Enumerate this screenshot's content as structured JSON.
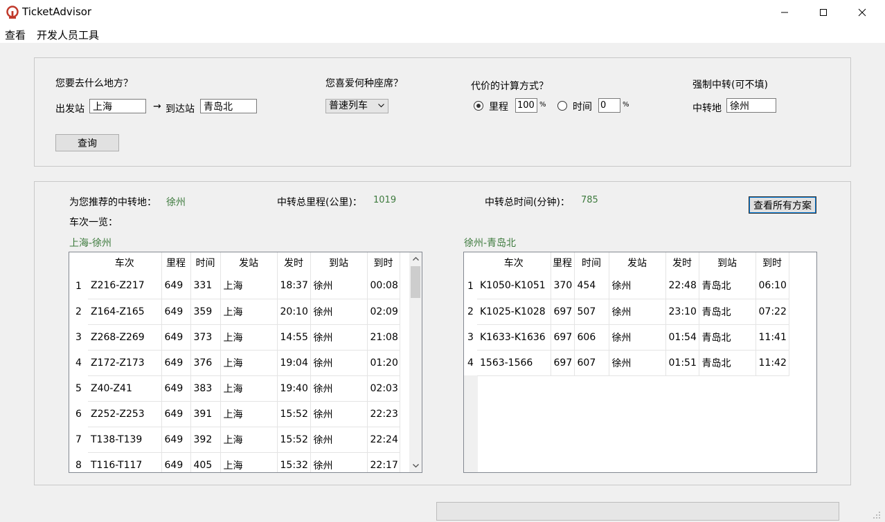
{
  "window": {
    "title": "TicketAdvisor",
    "brand_color": "#c0392b"
  },
  "menu": [
    "查看",
    "开发人员工具"
  ],
  "query": {
    "dest_question": "您要去什么地方？",
    "from_label": "出发站",
    "from_value": "上海",
    "arrow": "→",
    "to_label": "到达站",
    "to_value": "青岛北",
    "seat_question": "您喜爱何种座席？",
    "seat_value": "普速列车",
    "cost_question": "代价的计算方式？",
    "mileage_label": "里程",
    "mileage_value": "100",
    "time_label": "时间",
    "time_value": "0",
    "percent": "%",
    "transfer_question": "强制中转(可不填)",
    "transfer_label": "中转地",
    "transfer_value": "徐州",
    "search_button": "查询"
  },
  "result": {
    "recommend_label": "为您推荐的中转地：",
    "recommend_value": "徐州",
    "distance_label": "中转总里程(公里)：",
    "distance_value": "1019",
    "duration_label": "中转总时间(分钟)：",
    "duration_value": "785",
    "view_all_button": "查看所有方案",
    "trains_label": "车次一览：",
    "headers": [
      "车次",
      "里程",
      "时间",
      "发站",
      "到站",
      "发时",
      "到时"
    ],
    "leg1": {
      "title": "上海-徐州",
      "rows": [
        [
          "1",
          "Z216-Z217",
          "649",
          "331",
          "上海",
          "18:37",
          "徐州",
          "00:08"
        ],
        [
          "2",
          "Z164-Z165",
          "649",
          "359",
          "上海",
          "20:10",
          "徐州",
          "02:09"
        ],
        [
          "3",
          "Z268-Z269",
          "649",
          "373",
          "上海",
          "14:55",
          "徐州",
          "21:08"
        ],
        [
          "4",
          "Z172-Z173",
          "649",
          "376",
          "上海",
          "19:04",
          "徐州",
          "01:20"
        ],
        [
          "5",
          "Z40-Z41",
          "649",
          "383",
          "上海",
          "19:40",
          "徐州",
          "02:03"
        ],
        [
          "6",
          "Z252-Z253",
          "649",
          "391",
          "上海",
          "15:52",
          "徐州",
          "22:23"
        ],
        [
          "7",
          "T138-T139",
          "649",
          "392",
          "上海",
          "15:52",
          "徐州",
          "22:24"
        ],
        [
          "8",
          "T116-T117",
          "649",
          "405",
          "上海",
          "15:32",
          "徐州",
          "22:17"
        ]
      ]
    },
    "leg2": {
      "title": "徐州-青岛北",
      "rows": [
        [
          "1",
          "K1050-K1051",
          "370",
          "454",
          "徐州",
          "22:48",
          "青岛北",
          "06:10"
        ],
        [
          "2",
          "K1025-K1028",
          "697",
          "507",
          "徐州",
          "23:10",
          "青岛北",
          "07:22"
        ],
        [
          "3",
          "K1633-K1636",
          "697",
          "606",
          "徐州",
          "01:54",
          "青岛北",
          "11:41"
        ],
        [
          "4",
          "1563-1566",
          "697",
          "607",
          "徐州",
          "01:51",
          "青岛北",
          "11:42"
        ]
      ]
    }
  }
}
